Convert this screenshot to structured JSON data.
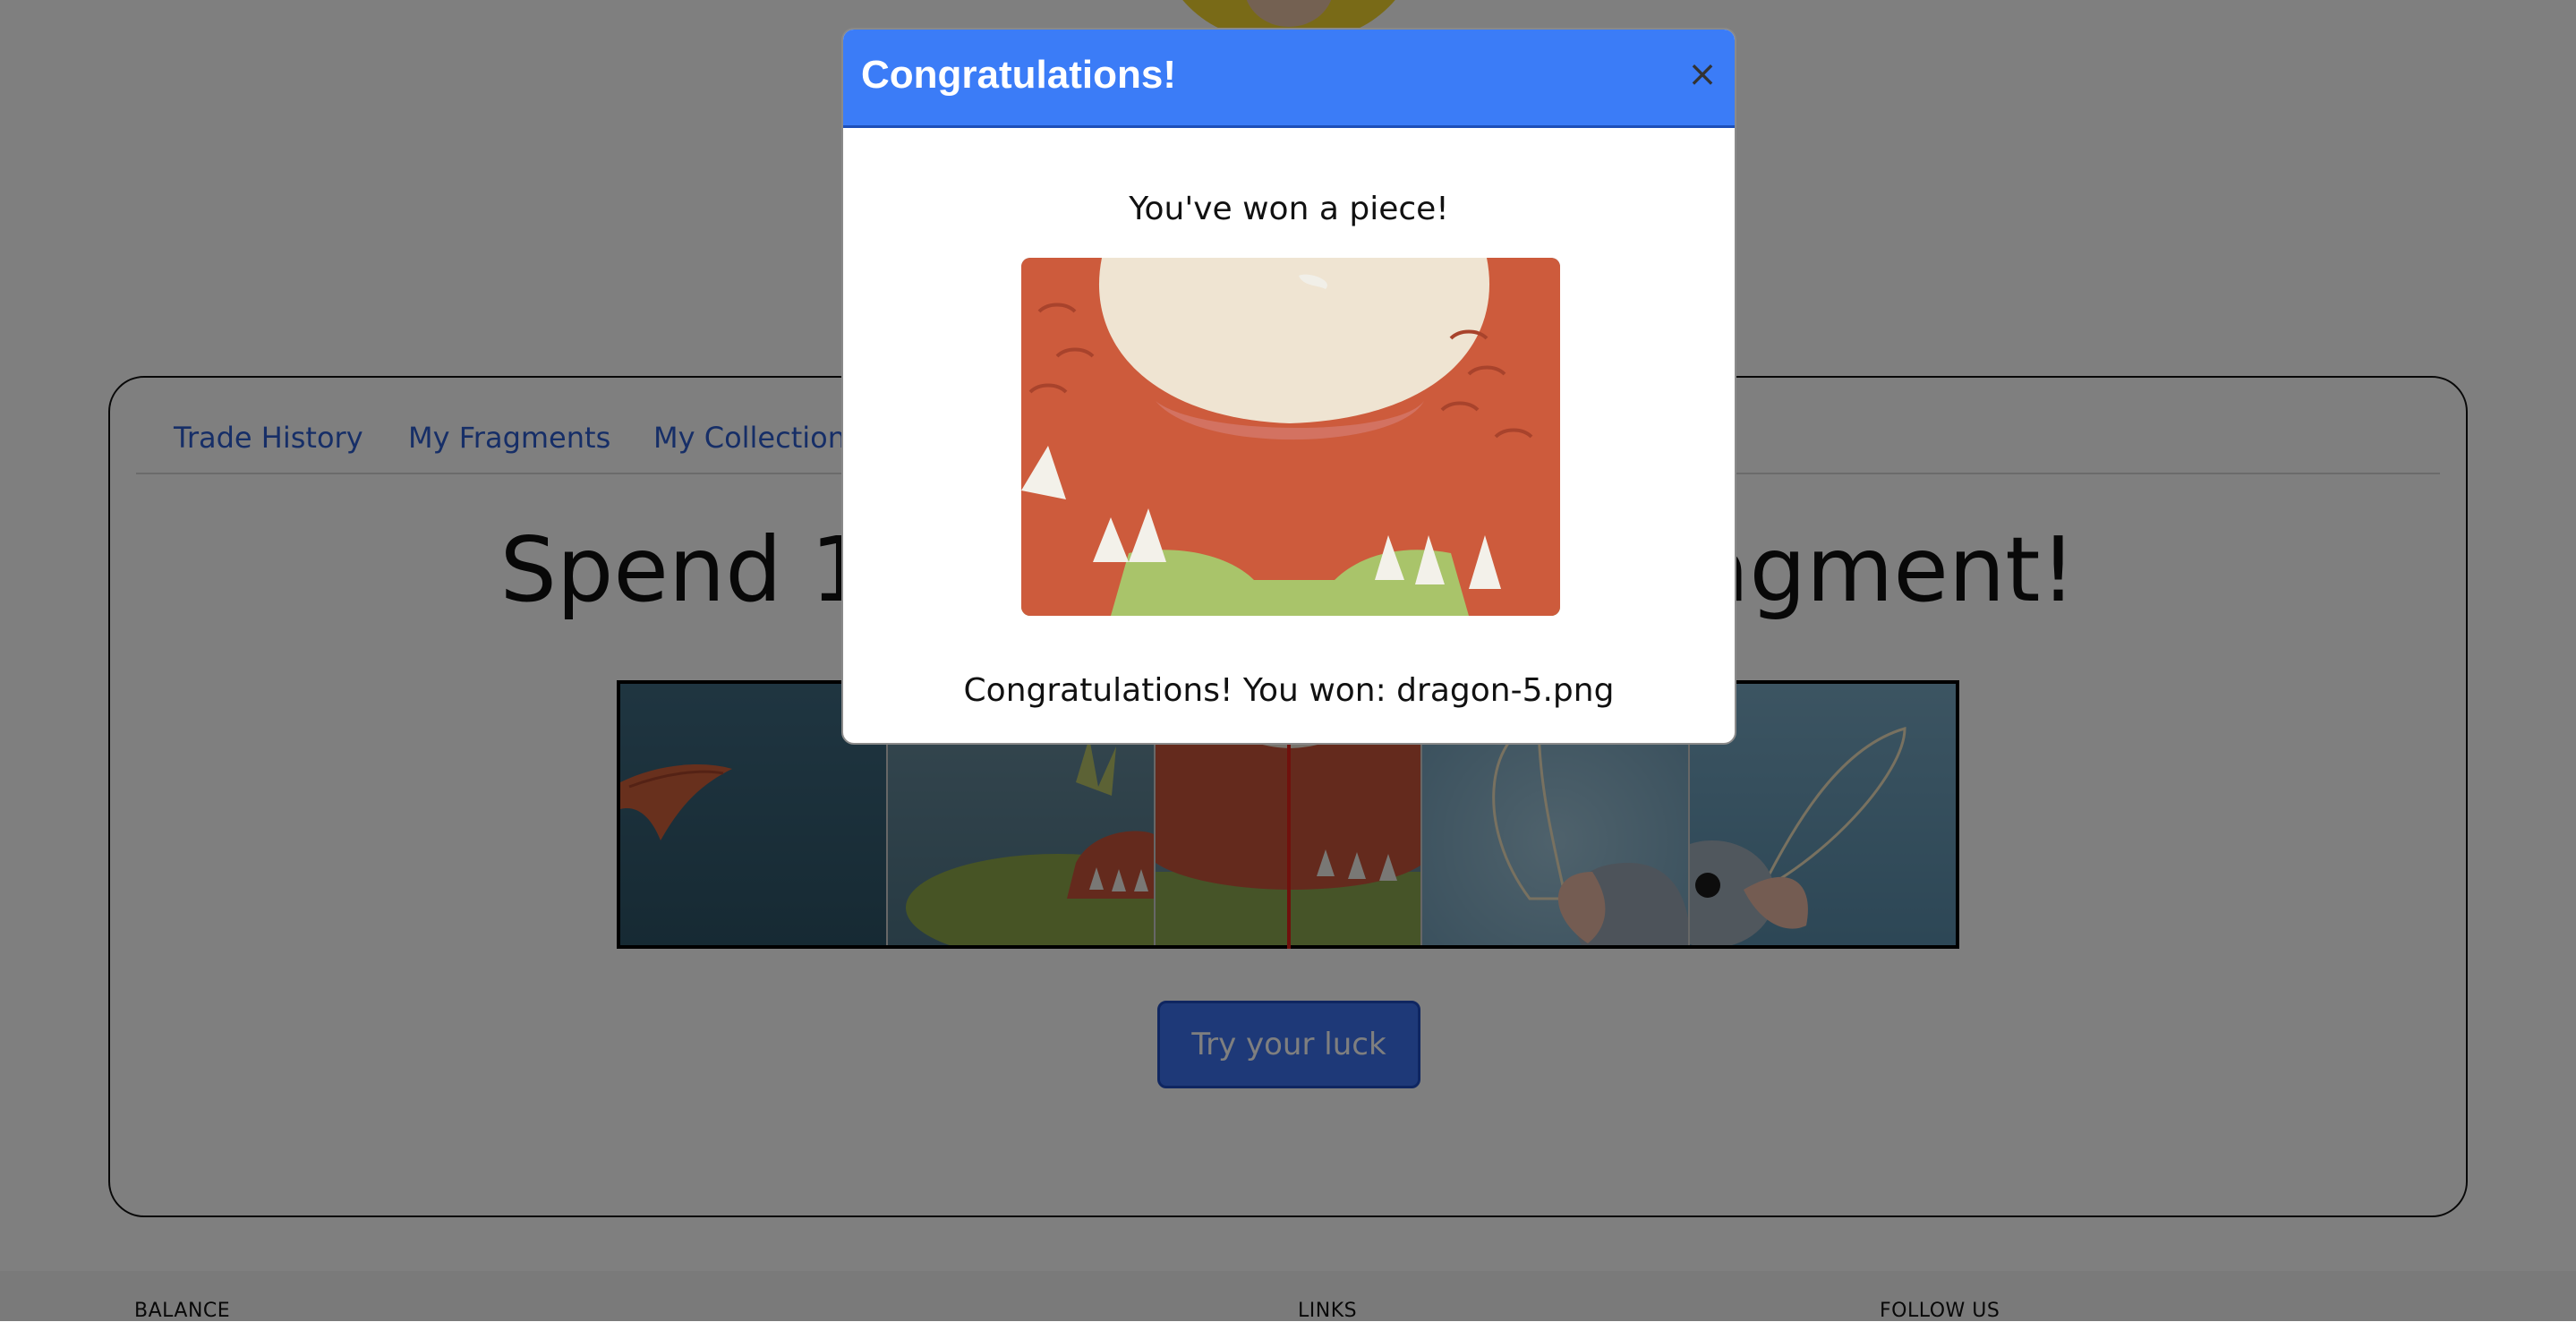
{
  "tabs": [
    {
      "label": "Trade History"
    },
    {
      "label": "My Fragments"
    },
    {
      "label": "My Collection"
    }
  ],
  "headline": {
    "left": "Spend 1",
    "right": "agment!"
  },
  "spin": {
    "button_label": "Try your luck"
  },
  "footer": {
    "balance": "BALANCE",
    "links": "LINKS",
    "follow_us": "FOLLOW US"
  },
  "modal": {
    "title": "Congratulations!",
    "close_symbol": "×",
    "subtitle": "You've won a piece!",
    "message": "Congratulations! You won: dragon-5.png"
  },
  "colors": {
    "header_blue": "#3b7cf7",
    "tab_link": "#2c5ccf",
    "button_blue": "#3d73f0",
    "marker_red": "#e0231b"
  }
}
